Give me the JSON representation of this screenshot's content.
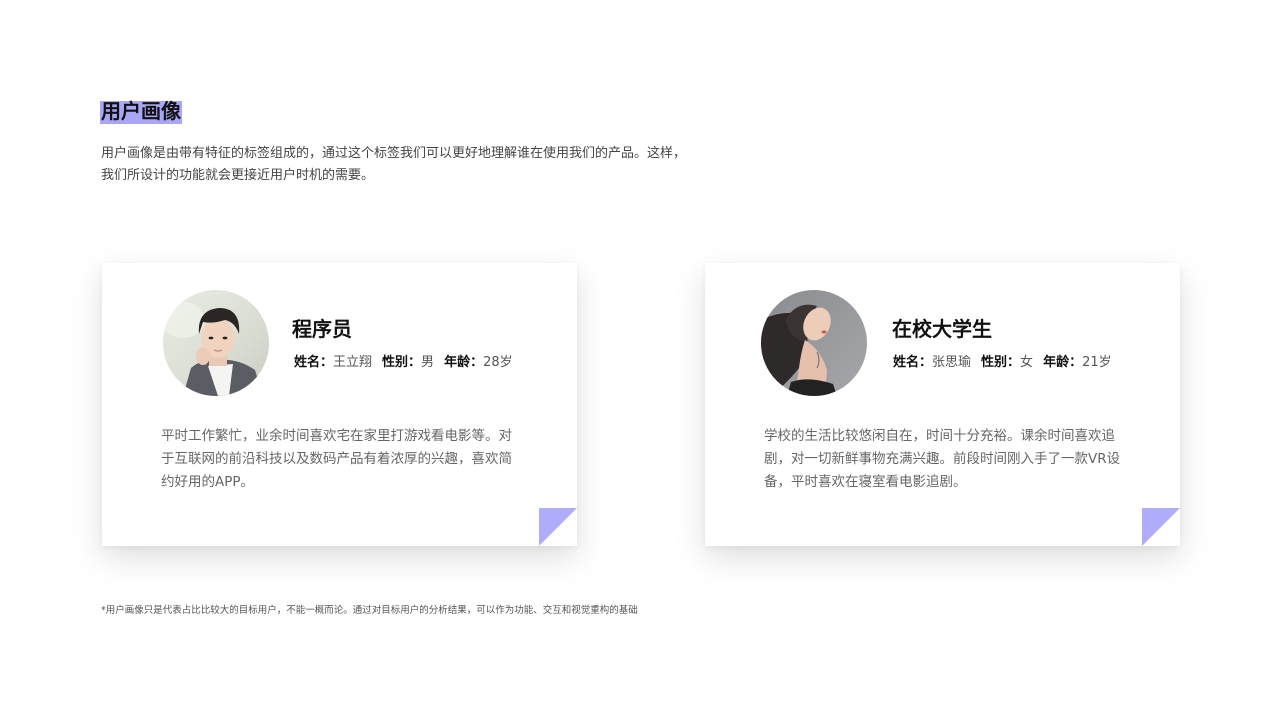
{
  "header": {
    "title": "用户画像",
    "intro_line1": "用户画像是由带有特征的标签组成的，通过这个标签我们可以更好地理解谁在使用我们的产品。这样，",
    "intro_line2": "我们所设计的功能就会更接近用户时机的需要。"
  },
  "personas": [
    {
      "role": "程序员",
      "name_label": "姓名：",
      "name": "王立翔",
      "gender_label": "性别：",
      "gender": "男",
      "age_label": "年龄：",
      "age": "28岁",
      "description": "平时工作繁忙，业余时间喜欢宅在家里打游戏看电影等。对于互联网的前沿科技以及数码产品有着浓厚的兴趣，喜欢简约好用的APP。",
      "avatar_icon": "male-user-photo"
    },
    {
      "role": "在校大学生",
      "name_label": "姓名：",
      "name": "张思瑜",
      "gender_label": "性别：",
      "gender": "女",
      "age_label": "年龄：",
      "age": "21岁",
      "description": "学校的生活比较悠闲自在，时间十分充裕。课余时间喜欢追剧，对一切新鲜事物充满兴趣。前段时间刚入手了一款VR设备，平时喜欢在寝室看电影追剧。",
      "avatar_icon": "female-user-photo"
    }
  ],
  "footnote": "*用户画像只是代表占比比较大的目标用户，不能一概而论。通过对目标用户的分析结果，可以作为功能、交互和视觉重构的基础",
  "colors": {
    "accent": "#a9a6f7",
    "fold_light": "#b7b4fb",
    "fold_dark": "#8f8bf0"
  }
}
